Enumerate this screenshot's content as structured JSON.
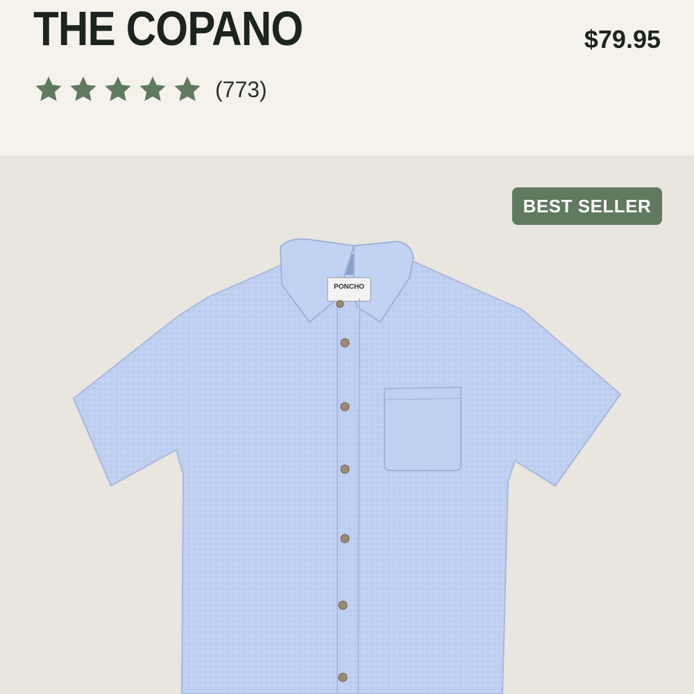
{
  "product": {
    "title": "THE COPANO",
    "price": "$79.95",
    "rating": {
      "stars": 5,
      "max_stars": 5,
      "review_count": "(773)",
      "star_icon": "star-icon",
      "star_color": "#5f7a5e"
    }
  },
  "image": {
    "badge": "BEST SELLER",
    "badge_color": "#5f7a5e",
    "label_brand": "PONCHO",
    "shirt_color": "#bccdf0"
  },
  "colors": {
    "header_bg": "#f5f2ec",
    "image_bg": "#e9e5df",
    "text": "#1d2420"
  }
}
